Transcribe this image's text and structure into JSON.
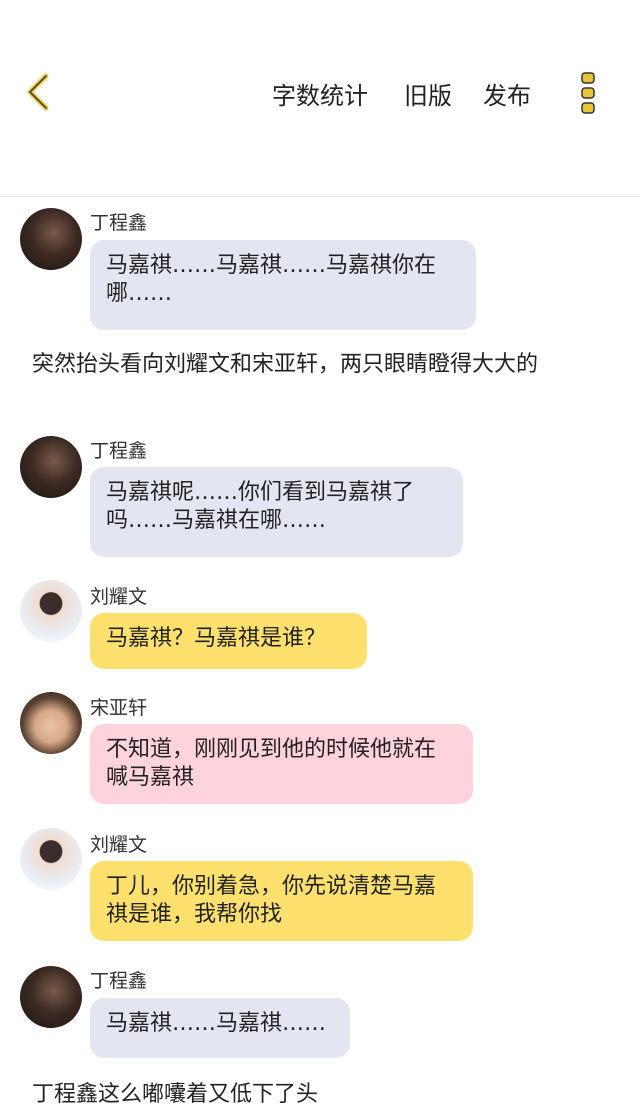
{
  "header": {
    "back_icon": "chevron-left-icon",
    "word_count": "字数统计",
    "old_version": "旧版",
    "publish": "发布",
    "more_icon": "vertical-dots-icon",
    "accent": "#e8c43b"
  },
  "chat": {
    "m1": {
      "name": "丁程鑫",
      "text": "马嘉祺……马嘉祺……马嘉祺你在哪……"
    },
    "n1": "突然抬头看向刘耀文和宋亚轩，两只眼睛瞪得大大的",
    "m2": {
      "name": "丁程鑫",
      "text": "马嘉祺呢……你们看到马嘉祺了吗……马嘉祺在哪……"
    },
    "m3": {
      "name": "刘耀文",
      "text": "马嘉祺？马嘉祺是谁？"
    },
    "m4": {
      "name": "宋亚轩",
      "text": "不知道，刚刚见到他的时候他就在喊马嘉祺"
    },
    "m5": {
      "name": "刘耀文",
      "text": "丁儿，你别着急，你先说清楚马嘉祺是谁，我帮你找"
    },
    "m6": {
      "name": "丁程鑫",
      "text": "马嘉祺……马嘉祺……"
    },
    "n2": "丁程鑫这么嘟囔着又低下了头"
  },
  "colors": {
    "bubble_gray": "#e3e6f1",
    "bubble_yellow": "#fde06e",
    "bubble_pink": "#ffd3dc"
  }
}
